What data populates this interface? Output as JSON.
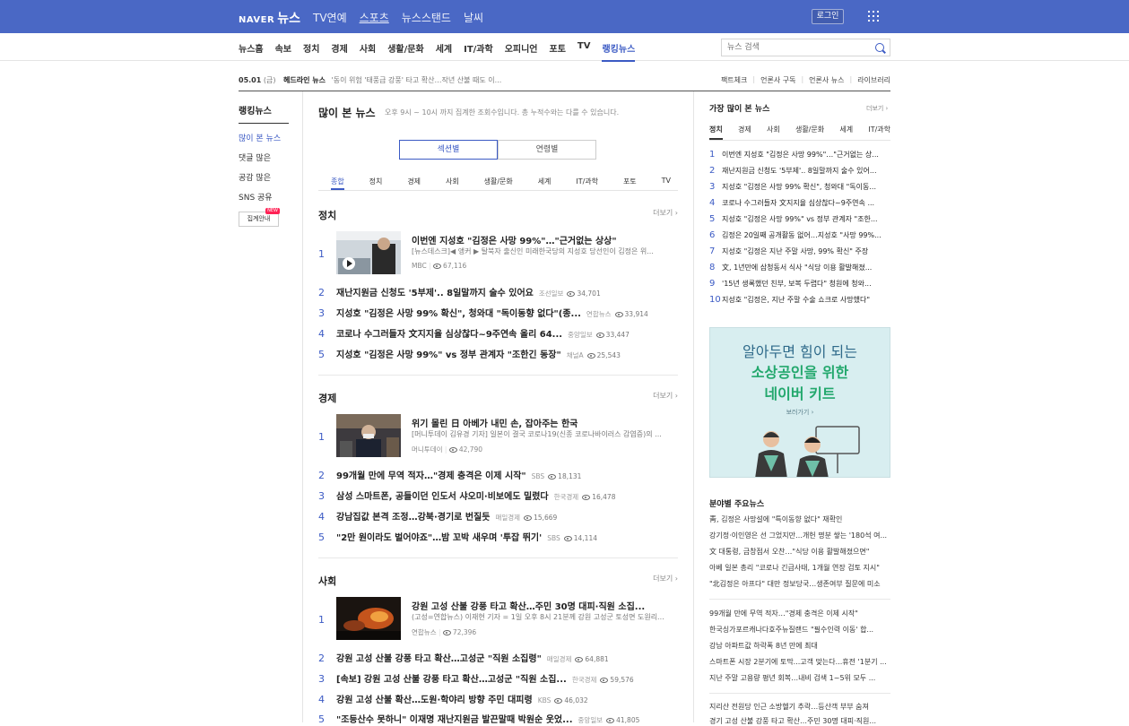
{
  "header": {
    "logo_naver": "NAVER",
    "logo_news": "뉴스",
    "nav": [
      "TV연예",
      "스포츠",
      "뉴스스탠드",
      "날씨"
    ],
    "login": "로그인"
  },
  "subnav": {
    "items": [
      "뉴스홈",
      "속보",
      "정치",
      "경제",
      "사회",
      "생활/문화",
      "세계",
      "IT/과학",
      "오피니언",
      "포토",
      "TV",
      "랭킹뉴스"
    ],
    "selected": "랭킹뉴스",
    "search_placeholder": "뉴스 검색"
  },
  "headline_bar": {
    "date": "05.01",
    "day": "(금)",
    "label": "헤드라인 뉴스",
    "text": "'동이 위험 '태풍급 강풍' 타고 확산…작년 산불 때도 이...",
    "links": [
      "팩트체크",
      "언론사 구독",
      "언론사 뉴스",
      "라이브러리"
    ]
  },
  "left_sidebar": {
    "title": "랭킹뉴스",
    "items": [
      "많이 본 뉴스",
      "댓글 많은",
      "공감 많은",
      "SNS 공유"
    ],
    "guide": "집계안내",
    "guide_badge": "NEW"
  },
  "main": {
    "title": "많이 본 뉴스",
    "desc": "오후 9시 ~ 10시 까지 집계한 조회수입니다. 총 누적수와는 다를 수 있습니다.",
    "toggle": [
      "섹션별",
      "연령별"
    ],
    "tabs": [
      "종합",
      "정치",
      "경제",
      "사회",
      "생활/문화",
      "세계",
      "IT/과학",
      "포토",
      "TV"
    ],
    "more": "더보기 ›",
    "sections": [
      {
        "name": "정치",
        "top": {
          "rank": "1",
          "title": "이번엔 지성호 \"김정은 사망 99%\"…\"근거없는 상상\"",
          "desc": "[뉴스데스크]◀ 앵커 ▶ 탈북자 출신인 미래한국당의 지성호 당선인이 김정은 위...",
          "press": "MBC",
          "views": "67,116"
        },
        "rows": [
          {
            "rank": "2",
            "title": "재난지원금 신청도 '5부제'.. 8일말까지 술수 있어요",
            "press": "조선일보",
            "views": "34,701"
          },
          {
            "rank": "3",
            "title": "지성호 \"김정은 사망 99% 확신\", 청와대 \"독이동향 없다\"(종...",
            "press": "연합뉴스",
            "views": "33,914"
          },
          {
            "rank": "4",
            "title": "코로나 수그러들자 文지지율 심상찮다~9주연속 올리 64...",
            "press": "중앙일보",
            "views": "33,447"
          },
          {
            "rank": "5",
            "title": "지성호 \"김정은 사망 99%\" vs 정부 관계자 \"조한긴 동장\"",
            "press": "채널A",
            "views": "25,543"
          }
        ]
      },
      {
        "name": "경제",
        "top": {
          "rank": "1",
          "title": "위기 몰린 日 아베가 내민 손, 잡아주는 한국",
          "desc": "[머니투데이 김유경 기자] 일본이 결국 코로나19(신종 코로나바이러스 감염증)의 ...",
          "press": "머니투데이",
          "views": "42,790"
        },
        "rows": [
          {
            "rank": "2",
            "title": "99개월 만에 무역 적자…\"경제 충격은 이제 시작\"",
            "press": "SBS",
            "views": "18,131"
          },
          {
            "rank": "3",
            "title": "삼성 스마트폰, 공들이던 인도서 샤오미·비보에도 밀렸다",
            "press": "한국경제",
            "views": "16,478"
          },
          {
            "rank": "4",
            "title": "강남집값 본격 조정…강북·경기로 번질듯",
            "press": "매일경제",
            "views": "15,669"
          },
          {
            "rank": "5",
            "title": "\"2만 원이라도 벌어야죠\"…밤 꼬박 새우며 '투잡 뛰기'",
            "press": "SBS",
            "views": "14,114"
          }
        ]
      },
      {
        "name": "사회",
        "top": {
          "rank": "1",
          "title": "강원 고성 산불 강풍 타고 확산…주민 30명 대피·직원 소집...",
          "desc": "(고성=연합뉴스) 이재현 기자 = 1일 오후 8시 21분께 강원 고성군 토성면 도원리...",
          "press": "연합뉴스",
          "views": "72,396"
        },
        "rows": [
          {
            "rank": "2",
            "title": "강원 고성 산불 강풍 타고 확산…고성군 \"직원 소집령\"",
            "press": "매일경제",
            "views": "64,881"
          },
          {
            "rank": "3",
            "title": "[속보] 강원 고성 산불 강풍 타고 확산…고성군 \"직원 소집...",
            "press": "한국경제",
            "views": "59,576"
          },
          {
            "rank": "4",
            "title": "강원 고성 산불 확산…도원·학야리 방향 주민 대피령",
            "press": "KBS",
            "views": "46,032"
          },
          {
            "rank": "5",
            "title": "\"조등산수 못하니\" 이재명 재난지원금 발끈말때 박원순 웃었...",
            "press": "중앙일보",
            "views": "41,805"
          }
        ]
      }
    ]
  },
  "right": {
    "title": "가장 많이 본 뉴스",
    "more": "더보기 ›",
    "tabs": [
      "정치",
      "경제",
      "사회",
      "생활/문화",
      "세계",
      "IT/과학"
    ],
    "ranking": [
      {
        "n": "1",
        "t": "이번엔 지성호 \"김정은 사망 99%\"…\"근거없는 상..."
      },
      {
        "n": "2",
        "t": "재난지원금 신청도 '5부제'.. 8일말까지 술수 있어..."
      },
      {
        "n": "3",
        "t": "지성호 \"김정은 사망 99% 확신\", 청와대 \"독이동..."
      },
      {
        "n": "4",
        "t": "코로나 수그러들자 文지지율 심상찮다~9주연속 ..."
      },
      {
        "n": "5",
        "t": "지성호 \"김정은 사망 99%\" vs 정부 관계자 \"조한..."
      },
      {
        "n": "6",
        "t": "김정은 20일째 공개활동 없어…지성호 \"사망 99%..."
      },
      {
        "n": "7",
        "t": "지성호 \"김정은 지난 주말 사망, 99% 확신\" 주장"
      },
      {
        "n": "8",
        "t": "文, 1년만에 삼청동서 식사 \"식당 이용 활발해졌..."
      },
      {
        "n": "9",
        "t": "'15년 생록했던 친부, 보복 두렵다\" 청원에 청와..."
      },
      {
        "n": "10",
        "t": "지성호 \"김정은, 지난 주말 수술 쇼크로 사망했다\""
      }
    ],
    "ad": {
      "line1": "알아두면 힘이 되는",
      "line2": "소상공인을 위한",
      "line3": "네이버 키트",
      "cta": "보러가기 ›"
    },
    "section_news_title": "분야별 주요뉴스",
    "group1": [
      "靑, 김정은 사망설에 \"특이동향 없다\" 재확인",
      "강기정·이인영은 선 그었지만…개헌 명분 쌓는 '180석 여...",
      "文 대통령, 금창점서 오찬…\"식당 이용 활발해졌으면\"",
      "아베 일본 총리 \"코로나 긴급사태, 1개월 연장 검토 지시\"",
      "\"北김정은 아프다\" 대만 정보당국…생존여부 질문에 미소"
    ],
    "group2": [
      "99개월 만에 무역 적자…\"경제 충격은 이제 시작\"",
      "한국싱가포르캐나다호주뉴질랜드 \"필수인력 이동' 합...",
      "강남 아파트값 하락폭 8년 만에 최대",
      "스마트폰 시장 2분기에 토막...고객 맞는다...휴전 '1분기 ...",
      "지난 주말 고용량 평년 회복…내비 검색 1~5위 모두 ..."
    ],
    "group3": [
      "지리산 전원당 인근 소방헬기 추락…등산객 부부 숨져",
      "경기 고성 산불 강풍 타고 확산…주민 30명 대피·직원..."
    ]
  }
}
